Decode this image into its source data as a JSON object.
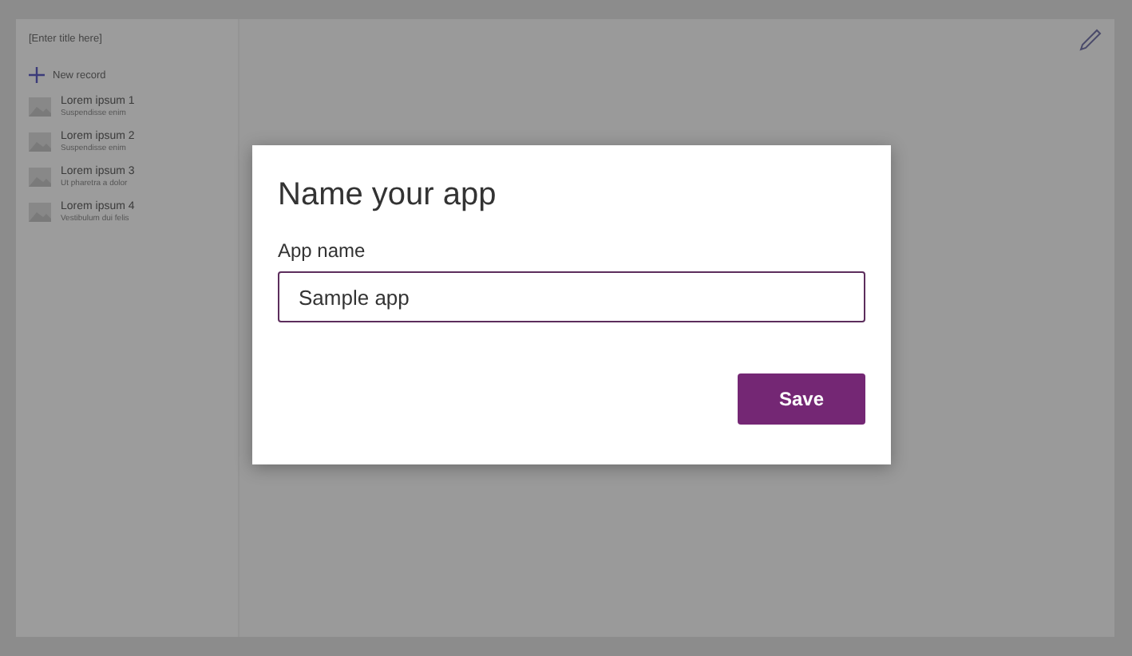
{
  "screen": {
    "title": "[Enter title here]",
    "new_record": "New record",
    "records": [
      {
        "title": "Lorem ipsum 1",
        "subtitle": "Suspendisse enim"
      },
      {
        "title": "Lorem ipsum 2",
        "subtitle": "Suspendisse enim"
      },
      {
        "title": "Lorem ipsum 3",
        "subtitle": "Ut pharetra a dolor"
      },
      {
        "title": "Lorem ipsum 4",
        "subtitle": "Vestibulum dui felis"
      }
    ]
  },
  "dialog": {
    "title": "Name your app",
    "field_label": "App name",
    "field_value": "Sample app",
    "button": "Save"
  }
}
